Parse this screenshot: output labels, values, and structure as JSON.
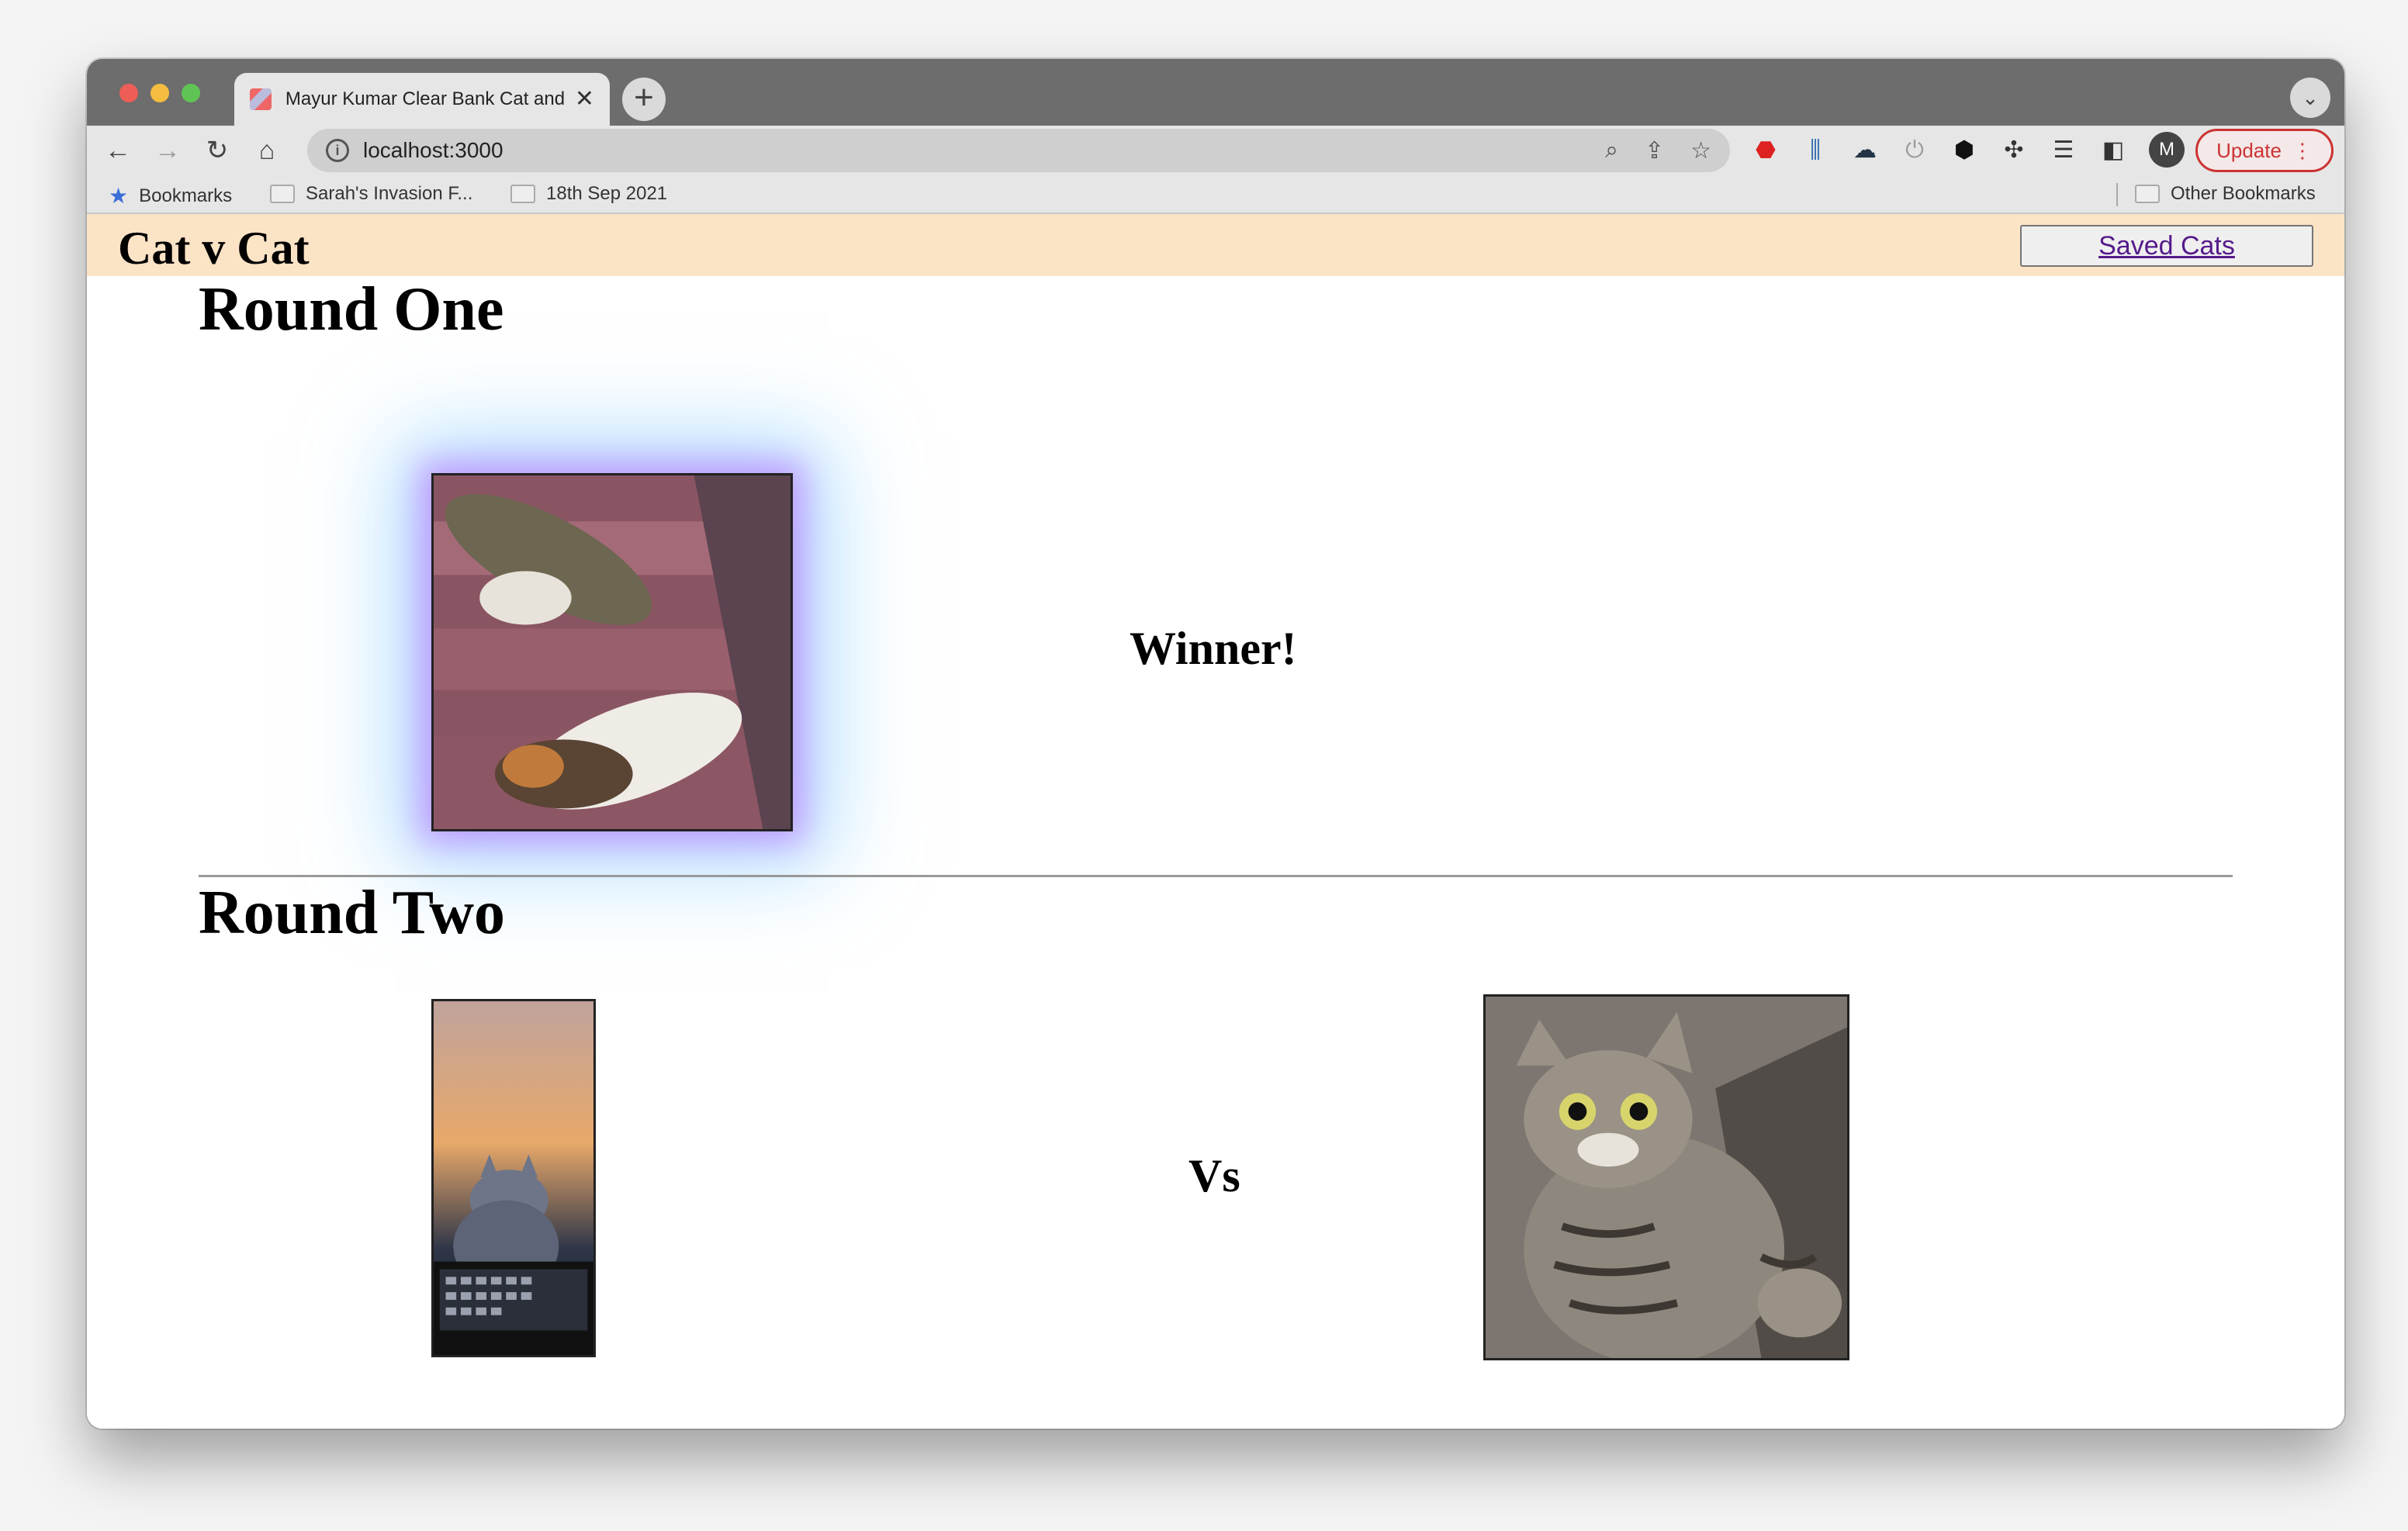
{
  "browser": {
    "tab_title": "Mayur Kumar Clear Bank Cat and",
    "tab_close": "✕",
    "new_tab": "+",
    "tab_menu": "⌄",
    "url": "localhost:3000",
    "update_label": "Update",
    "update_menu": "⋮",
    "avatar_letter": "M",
    "bookmarks": {
      "label": "Bookmarks",
      "items": [
        "Sarah's Invasion F...",
        "18th Sep 2021"
      ],
      "other": "Other Bookmarks"
    }
  },
  "app": {
    "title": "Cat v Cat",
    "saved_cats_label": "Saved Cats"
  },
  "rounds": [
    {
      "heading": "Round One",
      "status": "Winner!"
    },
    {
      "heading": "Round Two",
      "status": "Vs"
    }
  ],
  "colors": {
    "header_bg": "#fbe3c6",
    "glow_inner": "#be8cff",
    "glow_outer": "#78c8ff",
    "update_accent": "#cc3333"
  }
}
